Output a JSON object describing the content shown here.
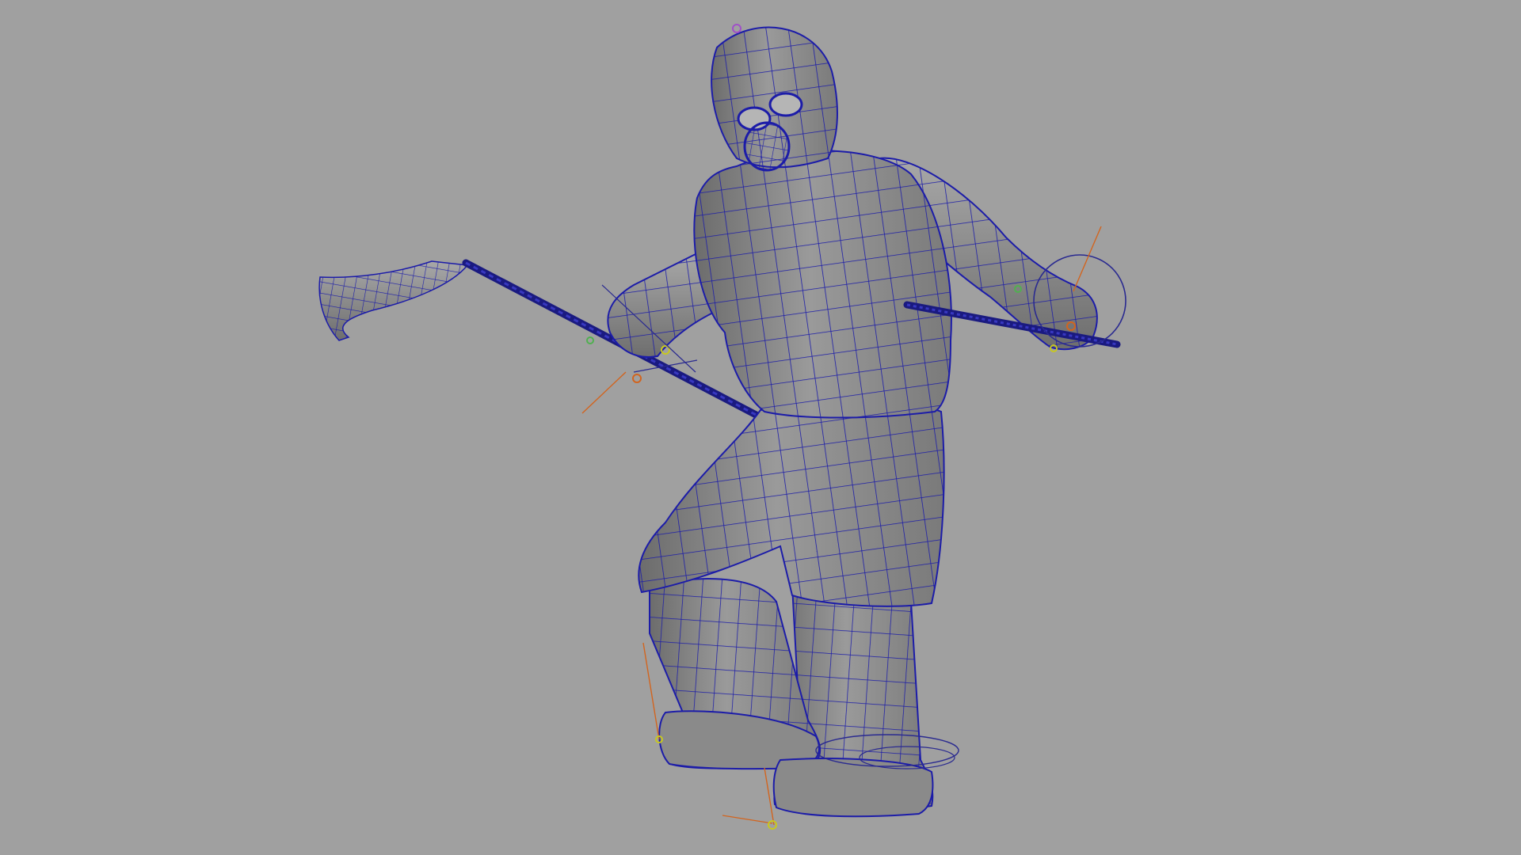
{
  "viewport": {
    "background_color": "#a0a0a0",
    "shading": "wireframe-on-shaded"
  },
  "model": {
    "surface_color": "#8f8f8f",
    "shadow_color": "#6c6c6c",
    "highlight_color": "#b4b4b4",
    "wire_color": "#1c1ca8",
    "controls": {
      "joint_color": "#c8c81e",
      "ik_line_color": "#d2641e",
      "locator_color": "#a050c8",
      "handle_color": "#2a2a90"
    }
  }
}
